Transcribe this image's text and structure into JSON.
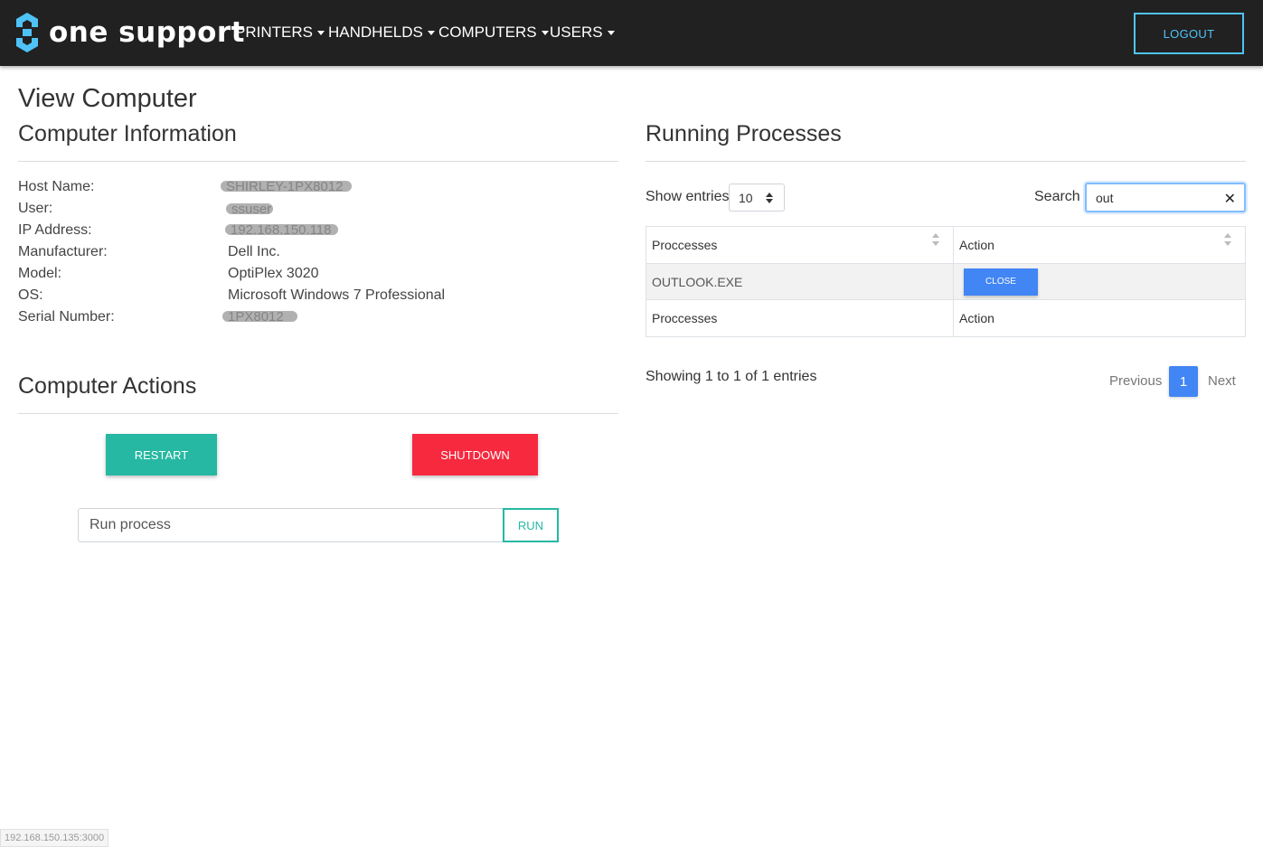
{
  "header": {
    "brand": "one support",
    "nav": [
      {
        "label": "PRINTERS"
      },
      {
        "label": "HANDHELDS"
      },
      {
        "label": "COMPUTERS"
      },
      {
        "label": "USERS"
      }
    ],
    "logout_label": "LOGOUT",
    "accent_color": "#4fc3f7"
  },
  "page": {
    "title": "View Computer"
  },
  "computer_info": {
    "heading": "Computer Information",
    "rows": [
      {
        "label": "Host Name:",
        "value": "SHIRLEY-1PX8012",
        "redacted": true
      },
      {
        "label": "User:",
        "value": "ssuser",
        "redacted": true
      },
      {
        "label": "IP Address:",
        "value": "192.168.150.118",
        "redacted": true
      },
      {
        "label": "Manufacturer:",
        "value": "Dell Inc."
      },
      {
        "label": "Model:",
        "value": "OptiPlex 3020"
      },
      {
        "label": "OS:",
        "value": "Microsoft Windows 7 Professional"
      },
      {
        "label": "Serial Number:",
        "value": "1PX8012",
        "redacted": true
      }
    ]
  },
  "computer_actions": {
    "heading": "Computer Actions",
    "restart_label": "RESTART",
    "shutdown_label": "SHUTDOWN",
    "run_placeholder": "Run process",
    "run_label": "RUN",
    "restart_color": "#26b8a2",
    "shutdown_color": "#f7293f"
  },
  "processes": {
    "heading": "Running Processes",
    "show_entries_label": "Show entries",
    "entries_value": "10",
    "search_label": "Search",
    "search_value": "out",
    "columns": [
      "Proccesses",
      "Action"
    ],
    "rows": [
      {
        "process": "OUTLOOK.EXE",
        "action_label": "CLOSE"
      }
    ],
    "footer_columns": [
      "Proccesses",
      "Action"
    ],
    "showing_text": "Showing 1 to 1 of 1 entries",
    "pagination": {
      "previous": "Previous",
      "current": "1",
      "next": "Next"
    }
  },
  "status_bar": {
    "url": "192.168.150.135:3000"
  }
}
